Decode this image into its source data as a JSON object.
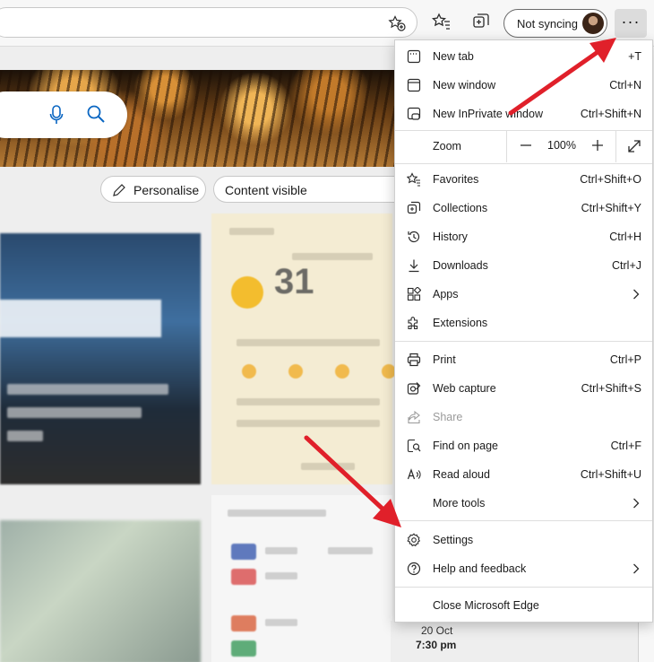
{
  "toolbar": {
    "sync_label": "Not syncing",
    "more_label": "···"
  },
  "page": {
    "personalise_label": "Personalise",
    "content_label": "Content visible",
    "match_date": "20 Oct",
    "match_time": "7:30 pm"
  },
  "menu": {
    "items": [
      {
        "label": "New tab",
        "shortcut": "+T",
        "icon": "new-tab-icon"
      },
      {
        "label": "New window",
        "shortcut": "Ctrl+N",
        "icon": "new-window-icon"
      },
      {
        "label": "New InPrivate window",
        "shortcut": "Ctrl+Shift+N",
        "icon": "inprivate-icon"
      },
      {
        "label": "Favorites",
        "shortcut": "Ctrl+Shift+O",
        "icon": "favorites-icon"
      },
      {
        "label": "Collections",
        "shortcut": "Ctrl+Shift+Y",
        "icon": "collections-icon"
      },
      {
        "label": "History",
        "shortcut": "Ctrl+H",
        "icon": "history-icon"
      },
      {
        "label": "Downloads",
        "shortcut": "Ctrl+J",
        "icon": "downloads-icon"
      },
      {
        "label": "Apps",
        "shortcut": "",
        "icon": "apps-icon"
      },
      {
        "label": "Extensions",
        "shortcut": "",
        "icon": "extensions-icon"
      },
      {
        "label": "Print",
        "shortcut": "Ctrl+P",
        "icon": "print-icon"
      },
      {
        "label": "Web capture",
        "shortcut": "Ctrl+Shift+S",
        "icon": "web-capture-icon"
      },
      {
        "label": "Share",
        "shortcut": "",
        "icon": "share-icon"
      },
      {
        "label": "Find on page",
        "shortcut": "Ctrl+F",
        "icon": "find-icon"
      },
      {
        "label": "Read aloud",
        "shortcut": "Ctrl+Shift+U",
        "icon": "read-aloud-icon"
      },
      {
        "label": "More tools",
        "shortcut": "",
        "icon": ""
      },
      {
        "label": "Settings",
        "shortcut": "",
        "icon": "settings-icon"
      },
      {
        "label": "Help and feedback",
        "shortcut": "",
        "icon": "help-icon"
      },
      {
        "label": "Close Microsoft Edge",
        "shortcut": "",
        "icon": ""
      }
    ],
    "zoom": {
      "label": "Zoom",
      "value": "100%"
    }
  },
  "colors": {
    "annotation_arrow": "#e0202a",
    "icon": "#2b2b2b"
  }
}
